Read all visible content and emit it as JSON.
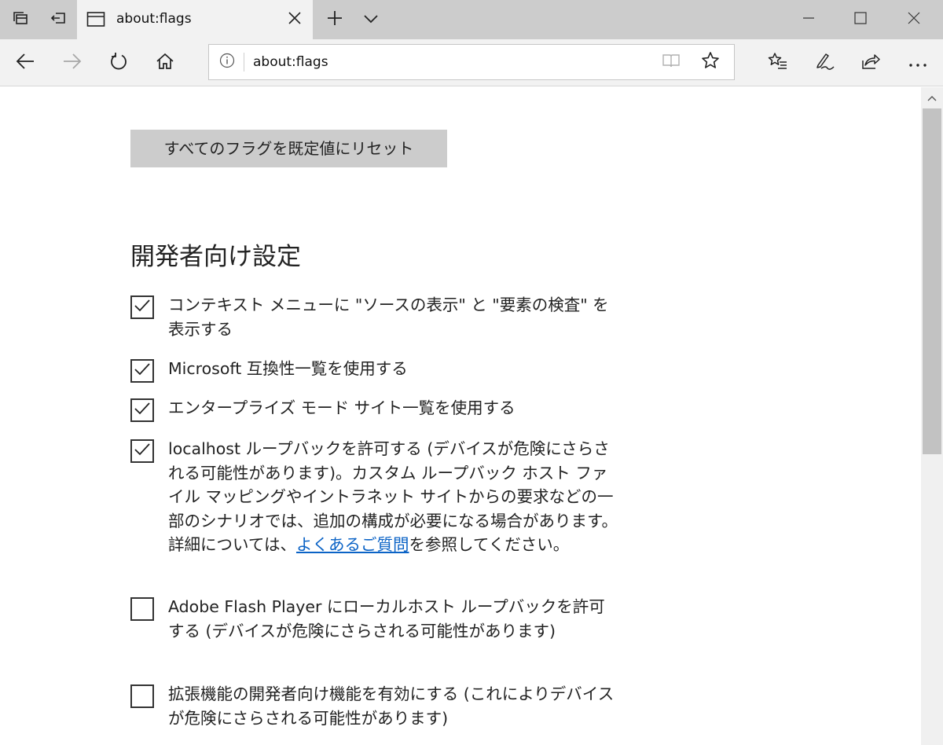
{
  "browser": {
    "tab": {
      "title": "about:flags"
    },
    "address_bar": {
      "url": "about:flags"
    }
  },
  "icons": {
    "tab_preview": "tabs-aside-icon",
    "set_aside": "set-aside-icon",
    "page": "page-icon",
    "close": "close-icon",
    "new_tab": "plus-icon",
    "tab_list": "chevron-down-icon",
    "minimize": "minimize-icon",
    "maximize": "maximize-icon",
    "window_close": "close-icon",
    "back": "back-arrow-icon",
    "forward": "forward-arrow-icon",
    "refresh": "refresh-icon",
    "home": "home-icon",
    "info": "info-icon",
    "reading_view": "book-icon",
    "favorite": "star-icon",
    "favorites_hub": "favorites-list-icon",
    "web_note": "pen-icon",
    "share": "share-icon",
    "more": "more-icon"
  },
  "page": {
    "reset_button": "すべてのフラグを既定値にリセット",
    "section_title": "開発者向け設定",
    "flags": [
      {
        "text": "コンテキスト メニューに \"ソースの表示\" と \"要素の検査\" を表示する",
        "checked": true
      },
      {
        "text": "Microsoft 互換性一覧を使用する",
        "checked": true
      },
      {
        "text": "エンタープライズ モード サイト一覧を使用する",
        "checked": true
      },
      {
        "text": "localhost ループバックを許可する (デバイスが危険にさらされる可能性があります)。カスタム ループバック ホスト ファイル マッピングやイントラネット サイトからの要求などの一部のシナリオでは、追加の構成が必要になる場合があります。詳細については、",
        "link": "よくあるご質問",
        "text_after": "を参照してください。",
        "checked": true
      },
      {
        "text": "Adobe Flash Player にローカルホスト ループバックを許可する (デバイスが危険にさらされる可能性があります)",
        "checked": false
      },
      {
        "text": "拡張機能の開発者向け機能を有効にする (これによりデバイスが危険にさらされる可能性があります)",
        "checked": false
      }
    ]
  },
  "colors": {
    "chrome": "#cccccc",
    "toolbar": "#f2f2f2",
    "link": "#0b63c6",
    "button": "#cccccc"
  }
}
